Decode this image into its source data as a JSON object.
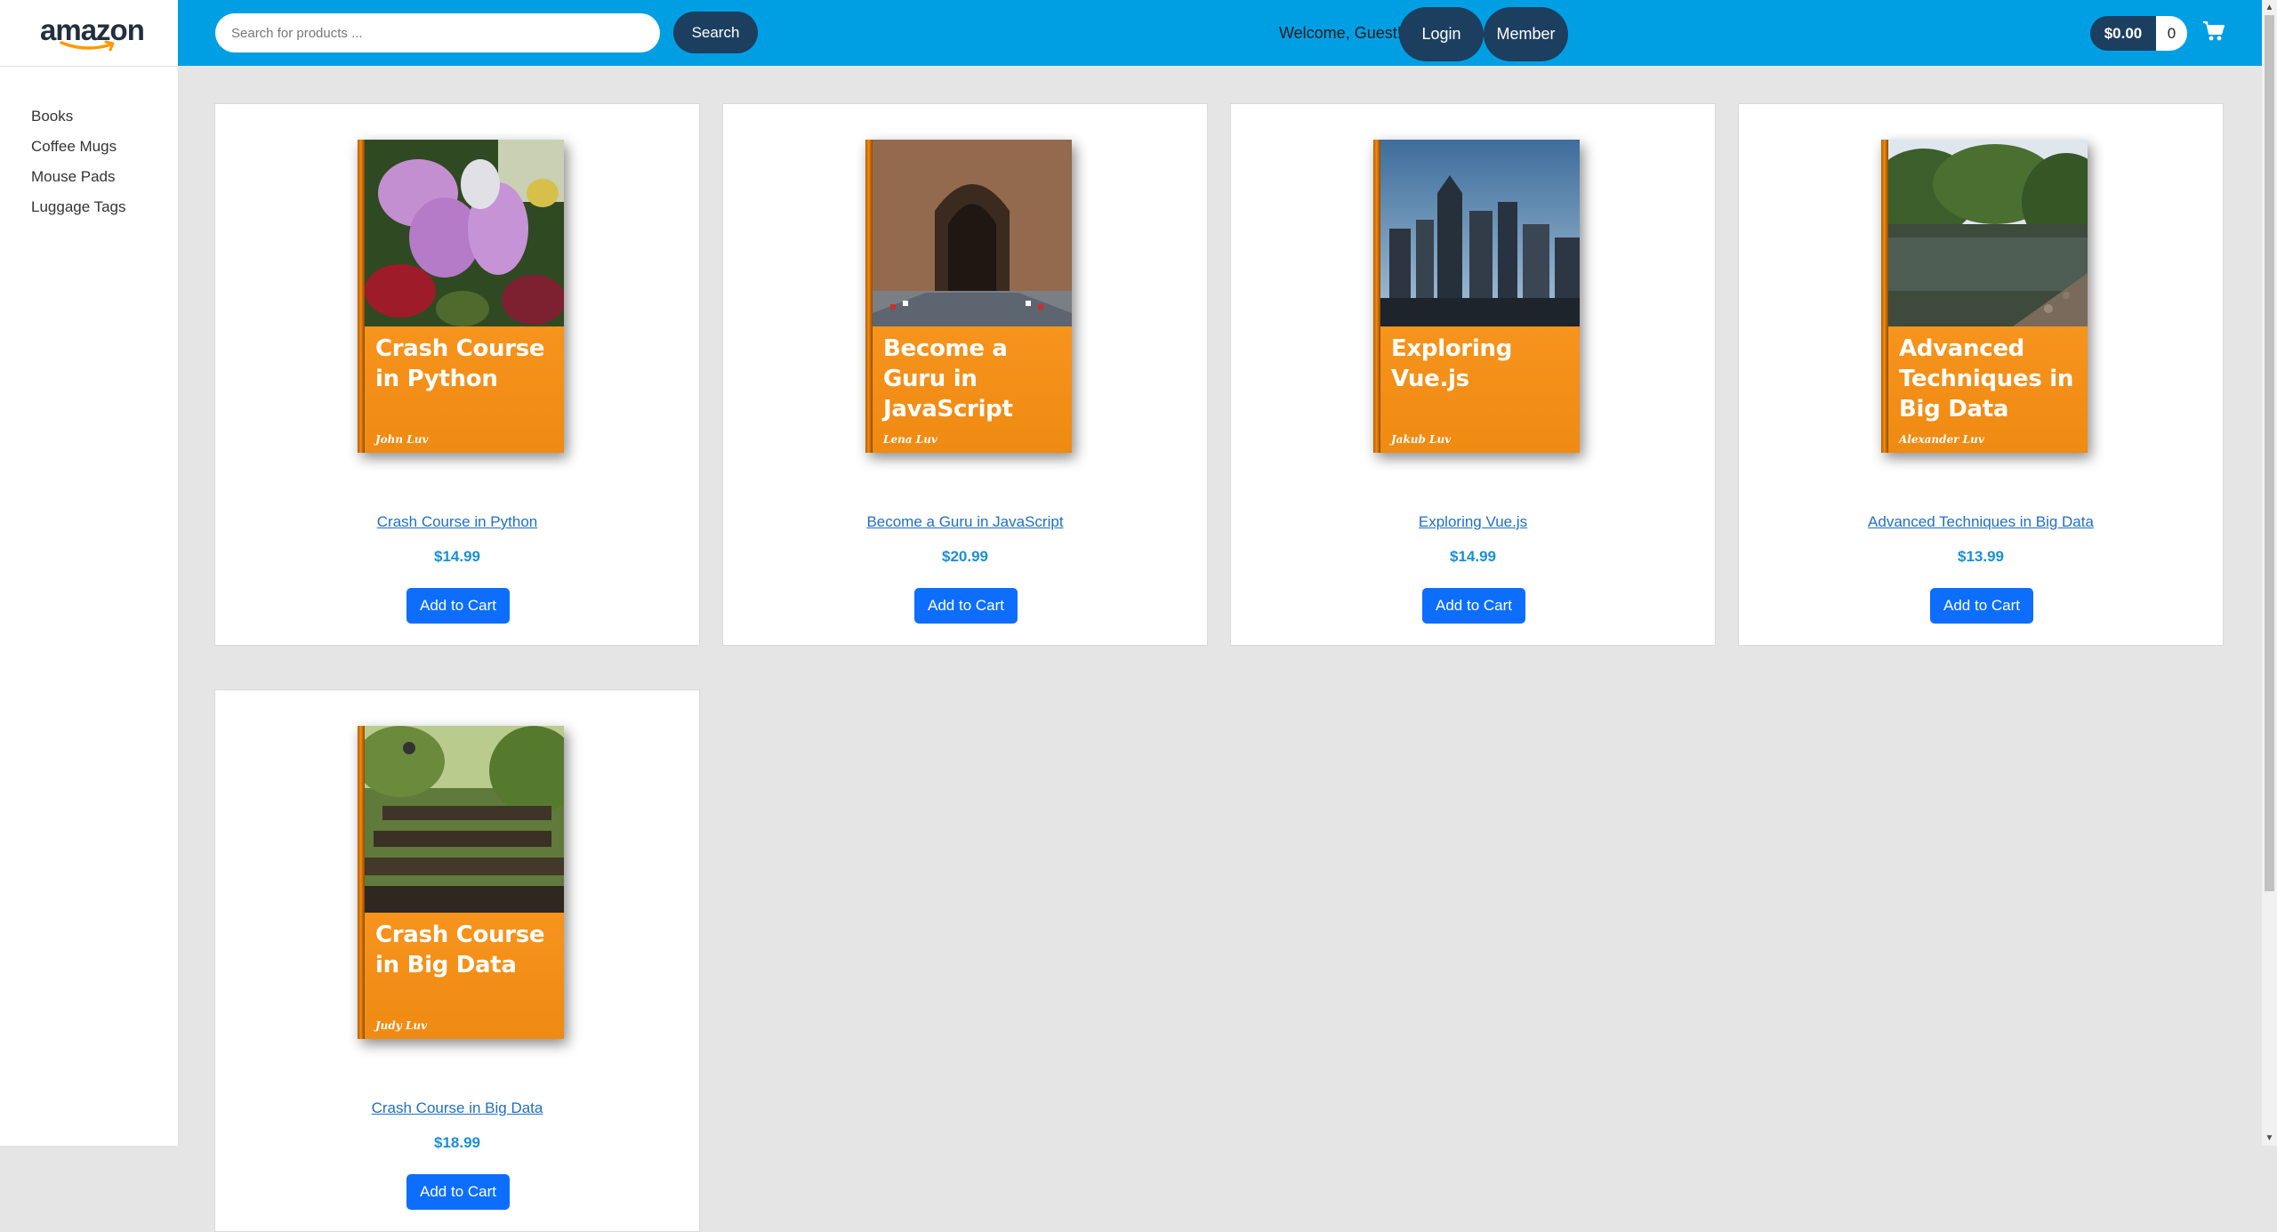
{
  "brand": {
    "logo_text": "amazon"
  },
  "sidebar": {
    "items": [
      {
        "label": "Books"
      },
      {
        "label": "Coffee Mugs"
      },
      {
        "label": "Mouse Pads"
      },
      {
        "label": "Luggage Tags"
      }
    ]
  },
  "header": {
    "search_placeholder": "Search for products ...",
    "search_label": "Search",
    "welcome_text": "Welcome, Guest!",
    "login_label": "Login",
    "member_label": "Member",
    "cart_total": "$0.00",
    "cart_count": "0",
    "cart_icon": "shopping-cart-icon"
  },
  "colors": {
    "header_bg": "#009fe3",
    "button_dark": "#1c3f60",
    "add_to_cart": "#0d6efd",
    "cover_band": "#f7941d",
    "price": "#1a8fd6"
  },
  "products": [
    {
      "cover_title": "Crash Course in Python",
      "cover_author": "John Luv",
      "name": "Crash Course in Python",
      "price": "$14.99",
      "button": "Add to Cart"
    },
    {
      "cover_title": "Become a Guru in JavaScript",
      "cover_author": "Lena Luv",
      "name": "Become a Guru in JavaScript",
      "price": "$20.99",
      "button": "Add to Cart"
    },
    {
      "cover_title": "Exploring Vue.js",
      "cover_author": "Jakub Luv",
      "name": "Exploring Vue.js",
      "price": "$14.99",
      "button": "Add to Cart"
    },
    {
      "cover_title": "Advanced Techniques in Big Data",
      "cover_author": "Alexander Luv",
      "name": "Advanced Techniques in Big Data",
      "price": "$13.99",
      "button": "Add to Cart"
    },
    {
      "cover_title": "Crash Course in Big Data",
      "cover_author": "Judy Luv",
      "name": "Crash Course in Big Data",
      "price": "$18.99",
      "button": "Add to Cart"
    }
  ]
}
